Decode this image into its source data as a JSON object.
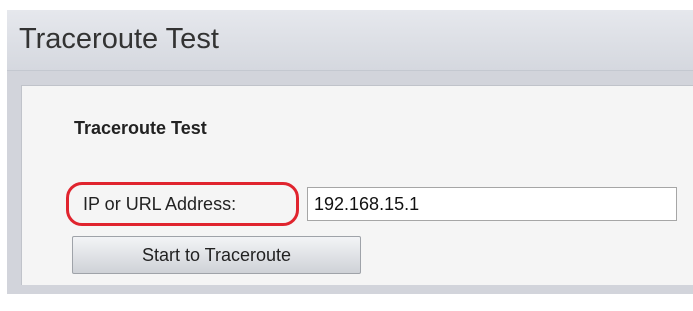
{
  "header": {
    "title": "Traceroute Test"
  },
  "panel": {
    "heading": "Traceroute Test",
    "address_label": "IP or URL Address:",
    "address_value": "192.168.15.1",
    "start_button_label": "Start to Traceroute"
  },
  "colors": {
    "highlight_ring": "#e0242e",
    "header_background": "#dcdfe5",
    "content_background": "#d2d4db",
    "panel_background": "#f5f5f5"
  }
}
